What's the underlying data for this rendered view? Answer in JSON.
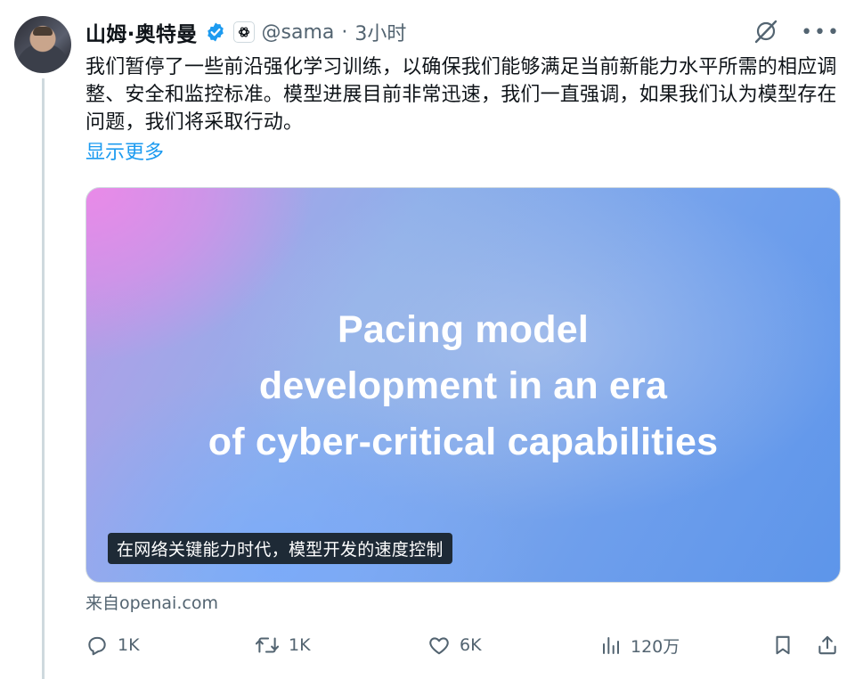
{
  "author": {
    "display_name": "山姆·奥特曼",
    "handle": "@sama",
    "separator": "·",
    "time": "3小时"
  },
  "tweet": {
    "text": "我们暂停了一些前沿强化学习训练，以确保我们能够满足当前新能力水平所需的相应调整、安全和监控标准。模型进展目前非常迅速，我们一直强调，如果我们认为模型存在问题，我们将采取行动。",
    "show_more": "显示更多"
  },
  "card": {
    "headline_lines": [
      "Pacing model",
      "development in an era",
      "of cyber-critical capabilities"
    ],
    "caption": "在网络关键能力时代，模型开发的速度控制",
    "source": "来自openai.com"
  },
  "actions": {
    "reply_count": "1K",
    "retweet_count": "1K",
    "like_count": "6K",
    "views_count": "120万"
  },
  "icons": {
    "verified": "verified-badge-icon",
    "org": "openai-logo-icon",
    "grok": "grok-icon",
    "more": "more-icon",
    "reply": "reply-icon",
    "retweet": "retweet-icon",
    "like": "like-icon",
    "views": "views-icon",
    "bookmark": "bookmark-icon",
    "share": "share-icon"
  },
  "colors": {
    "verified_blue": "#1d9bf0",
    "link_blue": "#1d9bf0",
    "secondary_text": "#536471"
  }
}
